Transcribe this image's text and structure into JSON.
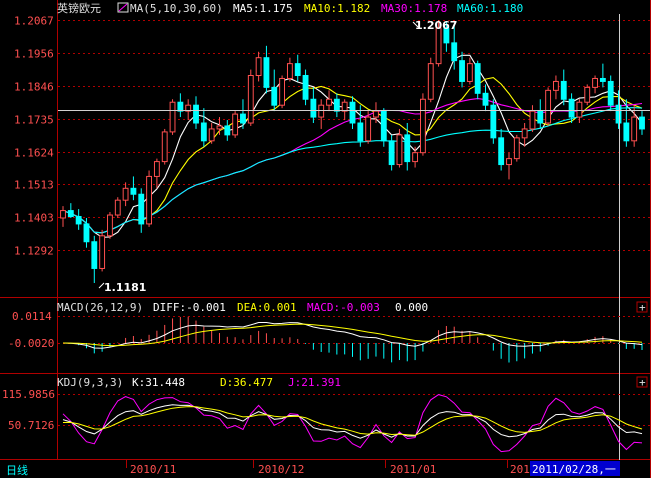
{
  "main_panel": {
    "symbol": "英镑欧元",
    "ma_label": "MA(5,10,30,60)",
    "ma5": "MA5:1.175",
    "ma10": "MA10:1.182",
    "ma30": "MA30:1.178",
    "ma60": "MA60:1.180",
    "high_marker": "1.2067",
    "low_marker": "1.1181"
  },
  "macd_panel": {
    "label": "MACD(26,12,9)",
    "diff": "DIFF:-0.001",
    "dea": "DEA:0.001",
    "macd": "MACD:-0.003",
    "extra": "0.000",
    "ticks": [
      "0.0114",
      "-0.0020"
    ]
  },
  "kdj_panel": {
    "label": "KDJ(9,3,3)",
    "k": "K:31.448",
    "d": "D:36.477",
    "j": "J:21.391",
    "ticks": [
      "115.9856",
      "50.7126"
    ]
  },
  "footer": {
    "period_tab": "日线",
    "dates": [
      "2010/11",
      "2010/12",
      "2011/01",
      "201"
    ],
    "cursor_date": "2011/02/28,一"
  },
  "colors": {
    "up": "#ff5050",
    "down": "#00ffff",
    "ma5": "#ffffff",
    "ma10": "#ffff00",
    "ma30": "#ff00ff",
    "ma60": "#00ffff",
    "frame": "#c00000",
    "cursor_bg": "#0000d0"
  },
  "chart_data": {
    "type": "candlestick",
    "price_ticks": [
      1.2067,
      1.1956,
      1.1846,
      1.1735,
      1.1624,
      1.1513,
      1.1403,
      1.1292
    ],
    "ylim": [
      1.1181,
      1.2067
    ],
    "candles": [
      [
        1.14,
        1.144,
        1.137,
        1.1425
      ],
      [
        1.1425,
        1.145,
        1.14,
        1.1405
      ],
      [
        1.1405,
        1.143,
        1.136,
        1.138
      ],
      [
        1.138,
        1.14,
        1.13,
        1.132
      ],
      [
        1.132,
        1.134,
        1.1181,
        1.123
      ],
      [
        1.123,
        1.136,
        1.122,
        1.134
      ],
      [
        1.134,
        1.142,
        1.133,
        1.141
      ],
      [
        1.141,
        1.147,
        1.14,
        1.146
      ],
      [
        1.146,
        1.152,
        1.144,
        1.15
      ],
      [
        1.15,
        1.154,
        1.146,
        1.148
      ],
      [
        1.148,
        1.15,
        1.135,
        1.138
      ],
      [
        1.138,
        1.156,
        1.137,
        1.154
      ],
      [
        1.154,
        1.16,
        1.15,
        1.159
      ],
      [
        1.159,
        1.17,
        1.158,
        1.169
      ],
      [
        1.169,
        1.18,
        1.168,
        1.179
      ],
      [
        1.179,
        1.182,
        1.174,
        1.176
      ],
      [
        1.176,
        1.18,
        1.173,
        1.178
      ],
      [
        1.178,
        1.181,
        1.17,
        1.172
      ],
      [
        1.172,
        1.177,
        1.164,
        1.166
      ],
      [
        1.166,
        1.172,
        1.165,
        1.17
      ],
      [
        1.17,
        1.174,
        1.168,
        1.171
      ],
      [
        1.171,
        1.173,
        1.166,
        1.168
      ],
      [
        1.168,
        1.176,
        1.167,
        1.175
      ],
      [
        1.175,
        1.18,
        1.17,
        1.172
      ],
      [
        1.172,
        1.19,
        1.171,
        1.188
      ],
      [
        1.188,
        1.196,
        1.186,
        1.194
      ],
      [
        1.194,
        1.198,
        1.182,
        1.184
      ],
      [
        1.184,
        1.19,
        1.176,
        1.178
      ],
      [
        1.178,
        1.188,
        1.177,
        1.187
      ],
      [
        1.187,
        1.194,
        1.186,
        1.192
      ],
      [
        1.192,
        1.195,
        1.186,
        1.188
      ],
      [
        1.188,
        1.19,
        1.178,
        1.18
      ],
      [
        1.18,
        1.184,
        1.172,
        1.174
      ],
      [
        1.174,
        1.18,
        1.17,
        1.178
      ],
      [
        1.178,
        1.183,
        1.176,
        1.18
      ],
      [
        1.18,
        1.182,
        1.174,
        1.176
      ],
      [
        1.176,
        1.18,
        1.173,
        1.179
      ],
      [
        1.179,
        1.181,
        1.17,
        1.172
      ],
      [
        1.172,
        1.178,
        1.164,
        1.166
      ],
      [
        1.166,
        1.176,
        1.165,
        1.174
      ],
      [
        1.174,
        1.179,
        1.172,
        1.176
      ],
      [
        1.176,
        1.177,
        1.164,
        1.166
      ],
      [
        1.166,
        1.168,
        1.156,
        1.158
      ],
      [
        1.158,
        1.17,
        1.157,
        1.168
      ],
      [
        1.168,
        1.172,
        1.156,
        1.159
      ],
      [
        1.159,
        1.164,
        1.157,
        1.162
      ],
      [
        1.162,
        1.182,
        1.161,
        1.18
      ],
      [
        1.18,
        1.194,
        1.179,
        1.192
      ],
      [
        1.192,
        1.2067,
        1.191,
        1.204
      ],
      [
        1.204,
        1.206,
        1.196,
        1.199
      ],
      [
        1.199,
        1.205,
        1.19,
        1.193
      ],
      [
        1.193,
        1.196,
        1.184,
        1.186
      ],
      [
        1.186,
        1.194,
        1.185,
        1.192
      ],
      [
        1.192,
        1.193,
        1.18,
        1.182
      ],
      [
        1.182,
        1.185,
        1.176,
        1.178
      ],
      [
        1.178,
        1.18,
        1.165,
        1.167
      ],
      [
        1.167,
        1.17,
        1.156,
        1.158
      ],
      [
        1.158,
        1.162,
        1.153,
        1.16
      ],
      [
        1.16,
        1.168,
        1.159,
        1.167
      ],
      [
        1.167,
        1.172,
        1.164,
        1.17
      ],
      [
        1.17,
        1.178,
        1.169,
        1.176
      ],
      [
        1.176,
        1.18,
        1.17,
        1.172
      ],
      [
        1.172,
        1.184,
        1.171,
        1.183
      ],
      [
        1.183,
        1.188,
        1.18,
        1.186
      ],
      [
        1.186,
        1.19,
        1.178,
        1.18
      ],
      [
        1.18,
        1.182,
        1.172,
        1.174
      ],
      [
        1.174,
        1.18,
        1.172,
        1.179
      ],
      [
        1.179,
        1.185,
        1.178,
        1.184
      ],
      [
        1.184,
        1.188,
        1.182,
        1.187
      ],
      [
        1.187,
        1.192,
        1.184,
        1.186
      ],
      [
        1.186,
        1.188,
        1.176,
        1.178
      ],
      [
        1.178,
        1.183,
        1.17,
        1.172
      ],
      [
        1.172,
        1.18,
        1.164,
        1.166
      ],
      [
        1.166,
        1.178,
        1.164,
        1.174
      ],
      [
        1.174,
        1.176,
        1.168,
        1.17
      ]
    ]
  }
}
